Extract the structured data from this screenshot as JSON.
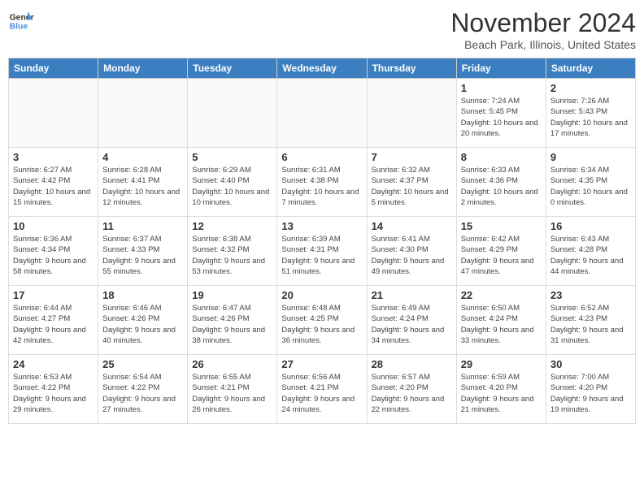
{
  "logo": {
    "line1": "General",
    "line2": "Blue"
  },
  "title": "November 2024",
  "subtitle": "Beach Park, Illinois, United States",
  "weekdays": [
    "Sunday",
    "Monday",
    "Tuesday",
    "Wednesday",
    "Thursday",
    "Friday",
    "Saturday"
  ],
  "weeks": [
    [
      {
        "day": "",
        "info": ""
      },
      {
        "day": "",
        "info": ""
      },
      {
        "day": "",
        "info": ""
      },
      {
        "day": "",
        "info": ""
      },
      {
        "day": "",
        "info": ""
      },
      {
        "day": "1",
        "info": "Sunrise: 7:24 AM\nSunset: 5:45 PM\nDaylight: 10 hours and 20 minutes."
      },
      {
        "day": "2",
        "info": "Sunrise: 7:26 AM\nSunset: 5:43 PM\nDaylight: 10 hours and 17 minutes."
      }
    ],
    [
      {
        "day": "3",
        "info": "Sunrise: 6:27 AM\nSunset: 4:42 PM\nDaylight: 10 hours and 15 minutes."
      },
      {
        "day": "4",
        "info": "Sunrise: 6:28 AM\nSunset: 4:41 PM\nDaylight: 10 hours and 12 minutes."
      },
      {
        "day": "5",
        "info": "Sunrise: 6:29 AM\nSunset: 4:40 PM\nDaylight: 10 hours and 10 minutes."
      },
      {
        "day": "6",
        "info": "Sunrise: 6:31 AM\nSunset: 4:38 PM\nDaylight: 10 hours and 7 minutes."
      },
      {
        "day": "7",
        "info": "Sunrise: 6:32 AM\nSunset: 4:37 PM\nDaylight: 10 hours and 5 minutes."
      },
      {
        "day": "8",
        "info": "Sunrise: 6:33 AM\nSunset: 4:36 PM\nDaylight: 10 hours and 2 minutes."
      },
      {
        "day": "9",
        "info": "Sunrise: 6:34 AM\nSunset: 4:35 PM\nDaylight: 10 hours and 0 minutes."
      }
    ],
    [
      {
        "day": "10",
        "info": "Sunrise: 6:36 AM\nSunset: 4:34 PM\nDaylight: 9 hours and 58 minutes."
      },
      {
        "day": "11",
        "info": "Sunrise: 6:37 AM\nSunset: 4:33 PM\nDaylight: 9 hours and 55 minutes."
      },
      {
        "day": "12",
        "info": "Sunrise: 6:38 AM\nSunset: 4:32 PM\nDaylight: 9 hours and 53 minutes."
      },
      {
        "day": "13",
        "info": "Sunrise: 6:39 AM\nSunset: 4:31 PM\nDaylight: 9 hours and 51 minutes."
      },
      {
        "day": "14",
        "info": "Sunrise: 6:41 AM\nSunset: 4:30 PM\nDaylight: 9 hours and 49 minutes."
      },
      {
        "day": "15",
        "info": "Sunrise: 6:42 AM\nSunset: 4:29 PM\nDaylight: 9 hours and 47 minutes."
      },
      {
        "day": "16",
        "info": "Sunrise: 6:43 AM\nSunset: 4:28 PM\nDaylight: 9 hours and 44 minutes."
      }
    ],
    [
      {
        "day": "17",
        "info": "Sunrise: 6:44 AM\nSunset: 4:27 PM\nDaylight: 9 hours and 42 minutes."
      },
      {
        "day": "18",
        "info": "Sunrise: 6:46 AM\nSunset: 4:26 PM\nDaylight: 9 hours and 40 minutes."
      },
      {
        "day": "19",
        "info": "Sunrise: 6:47 AM\nSunset: 4:26 PM\nDaylight: 9 hours and 38 minutes."
      },
      {
        "day": "20",
        "info": "Sunrise: 6:48 AM\nSunset: 4:25 PM\nDaylight: 9 hours and 36 minutes."
      },
      {
        "day": "21",
        "info": "Sunrise: 6:49 AM\nSunset: 4:24 PM\nDaylight: 9 hours and 34 minutes."
      },
      {
        "day": "22",
        "info": "Sunrise: 6:50 AM\nSunset: 4:24 PM\nDaylight: 9 hours and 33 minutes."
      },
      {
        "day": "23",
        "info": "Sunrise: 6:52 AM\nSunset: 4:23 PM\nDaylight: 9 hours and 31 minutes."
      }
    ],
    [
      {
        "day": "24",
        "info": "Sunrise: 6:53 AM\nSunset: 4:22 PM\nDaylight: 9 hours and 29 minutes."
      },
      {
        "day": "25",
        "info": "Sunrise: 6:54 AM\nSunset: 4:22 PM\nDaylight: 9 hours and 27 minutes."
      },
      {
        "day": "26",
        "info": "Sunrise: 6:55 AM\nSunset: 4:21 PM\nDaylight: 9 hours and 26 minutes."
      },
      {
        "day": "27",
        "info": "Sunrise: 6:56 AM\nSunset: 4:21 PM\nDaylight: 9 hours and 24 minutes."
      },
      {
        "day": "28",
        "info": "Sunrise: 6:57 AM\nSunset: 4:20 PM\nDaylight: 9 hours and 22 minutes."
      },
      {
        "day": "29",
        "info": "Sunrise: 6:59 AM\nSunset: 4:20 PM\nDaylight: 9 hours and 21 minutes."
      },
      {
        "day": "30",
        "info": "Sunrise: 7:00 AM\nSunset: 4:20 PM\nDaylight: 9 hours and 19 minutes."
      }
    ]
  ]
}
